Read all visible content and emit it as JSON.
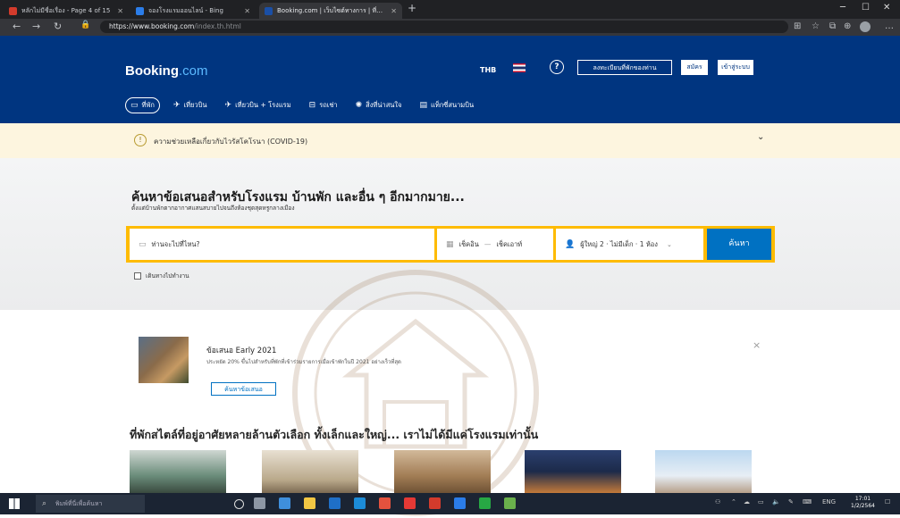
{
  "browser": {
    "tabs": [
      {
        "title": "หลักไม่มีชื่อเรื่อง - Page 4 of 15",
        "fav_color": "#d33b2c",
        "active": false
      },
      {
        "title": "จองโรงแรมออนไลน์ - Bing",
        "fav_color": "#2b7de9",
        "active": false
      },
      {
        "title": "Booking.com | เว็บไซต์ทางการ | ที่พักราคาดี",
        "fav_color": "#1a4fa6",
        "active": true
      }
    ],
    "new_tab": "+",
    "url_main": "https://www.booking.com",
    "url_faint": "/index.th.html"
  },
  "header": {
    "logo_main": "Booking",
    "logo_com": ".com",
    "currency": "THB",
    "help": "?",
    "list_property": "ลงทะเบียนที่พักของท่าน",
    "register": "สมัคร",
    "sign_in": "เข้าสู่ระบบ",
    "nav": [
      {
        "label": "ที่พัก",
        "icon": "bed-icon",
        "glyph": "🛏"
      },
      {
        "label": "เที่ยวบิน",
        "icon": "plane-icon",
        "glyph": "✈"
      },
      {
        "label": "เที่ยวบิน + โรงแรม",
        "icon": "flight-hotel-icon",
        "glyph": "✈"
      },
      {
        "label": "รถเช่า",
        "icon": "car-icon",
        "glyph": "🚗"
      },
      {
        "label": "สิ่งที่น่าสนใจ",
        "icon": "attraction-icon",
        "glyph": "✺"
      },
      {
        "label": "แท็กซี่สนามบิน",
        "icon": "taxi-icon",
        "glyph": "🚕"
      }
    ]
  },
  "covid": {
    "text": "ความช่วยเหลือเกี่ยวกับไวรัสโคโรนา (COVID-19)"
  },
  "hero": {
    "title": "ค้นหาข้อเสนอสำหรับโรงแรม บ้านพัก และอื่น ๆ อีกมากมาย...",
    "subtitle": "ตั้งแต่บ้านพักตากอากาศแสนสบายไปจนถึงห้องชุดสุดหรูกลางเมือง",
    "destination_placeholder": "ท่านจะไปที่ไหน?",
    "checkin": "เช็คอิน",
    "checkout": "เช็คเอาท์",
    "guests": "ผู้ใหญ่ 2 · ไม่มีเด็ก · 1 ห้อง",
    "search_button": "ค้นหา",
    "travel_for_work": "เดินทางไปทำงาน"
  },
  "promo": {
    "title": "ข้อเสนอ Early 2021",
    "text": "ประหยัด 20% ขึ้นไปสำหรับที่พักที่เข้าร่วมรายการเมื่อเข้าพักในปี 2021 อย่างเร็วที่สุด",
    "button": "ค้นหาข้อเสนอ",
    "close": "×"
  },
  "stay_title": "ที่พักสไตล์ที่อยู่อาศัยหลายล้านตัวเลือก ทั้งเล็กและใหญ่... เราไม่ได้มีแค่โรงแรมเท่านั้น",
  "taskbar": {
    "search_placeholder": "พิมพ์ที่นี่เพื่อค้นหา",
    "lang": "ENG",
    "time": "17:01",
    "date": "1/2/2564"
  },
  "colors": {
    "brand_blue": "#003580",
    "accent_blue": "#0071c2",
    "search_yellow": "#febb02",
    "covid_bg": "#fdf5df"
  }
}
